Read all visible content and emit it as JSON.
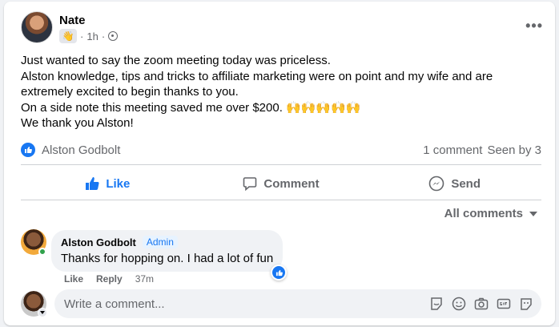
{
  "post": {
    "author": "Nate",
    "time": "1h",
    "separator": "·",
    "more_label": "•••",
    "lines": [
      "Just wanted to say the zoom meeting today was priceless.",
      "Alston knowledge, tips and tricks to affiliate marketing were on point and my wife and are",
      "extremely excited to begin thanks to you.",
      "On a side note this meeting saved me over $200. 🙌🙌🙌🙌🙌",
      "We thank you Alston!"
    ]
  },
  "reactions": {
    "names": "Alston Godbolt",
    "comment_count": "1 comment",
    "seen_by": "Seen by 3"
  },
  "actions": {
    "like": "Like",
    "comment": "Comment",
    "send": "Send"
  },
  "comments_filter": "All comments",
  "comment": {
    "author": "Alston Godbolt",
    "role": "Admin",
    "text": "Thanks for hopping on. I had a lot of fun",
    "like": "Like",
    "reply": "Reply",
    "time": "37m"
  },
  "composer": {
    "placeholder": "Write a comment..."
  },
  "colors": {
    "accent": "#1877f2",
    "muted": "#65676b",
    "online": "#31a24c"
  },
  "icons": [
    "more-icon",
    "wave-badge-icon",
    "globe-icon",
    "like-icon",
    "comment-icon",
    "messenger-icon",
    "caret-down-icon",
    "sticker-icon",
    "emoji-icon",
    "camera-icon",
    "gif-icon",
    "avatar-sticker-icon"
  ]
}
